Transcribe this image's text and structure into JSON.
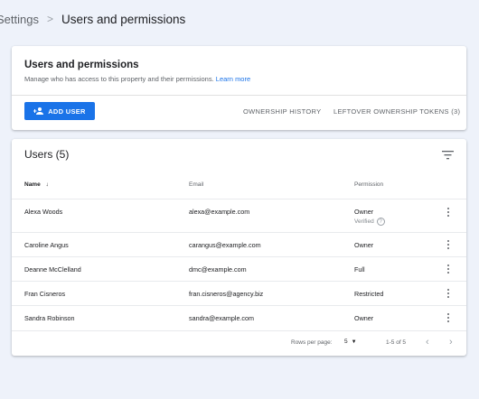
{
  "breadcrumb": {
    "parent": "Settings",
    "separator": ">",
    "current": "Users and permissions"
  },
  "top_card": {
    "title": "Users and permissions",
    "description": "Manage who has access to this property and their permissions.",
    "learn_more": "Learn more",
    "add_user": "ADD USER",
    "ownership_history": "OWNERSHIP HISTORY",
    "leftover_tokens": "LEFTOVER OWNERSHIP TOKENS (3)"
  },
  "users_card": {
    "title": "Users (5)",
    "columns": {
      "name": "Name",
      "email": "Email",
      "permission": "Permission"
    },
    "sort_icon": "arrow-down-icon",
    "rows": [
      {
        "name": "Alexa Woods",
        "email": "alexa@example.com",
        "permission": "Owner",
        "note": "Verified"
      },
      {
        "name": "Caroline Angus",
        "email": "carangus@example.com",
        "permission": "Owner"
      },
      {
        "name": "Deanne McClelland",
        "email": "dmc@example.com",
        "permission": "Full"
      },
      {
        "name": "Fran Cisneros",
        "email": "fran.cisneros@agency.biz",
        "permission": "Restricted"
      },
      {
        "name": "Sandra Robinson",
        "email": "sandra@example.com",
        "permission": "Owner"
      }
    ],
    "footer": {
      "rows_per_page_label": "Rows per page:",
      "rows_per_page_value": "5",
      "range": "1-5 of 5",
      "prev": "‹",
      "next": "›"
    }
  },
  "colors": {
    "accent": "#1a73e8",
    "page_bg": "#eef2fa"
  }
}
